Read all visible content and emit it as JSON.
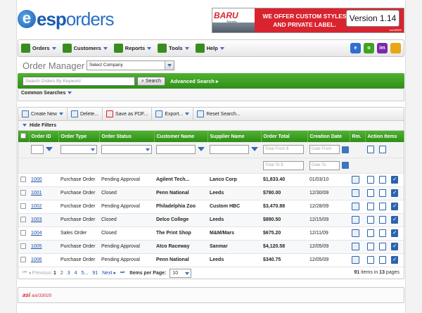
{
  "brand": {
    "logo_letter": "e",
    "logo_main": "esp",
    "logo_sub": "orders"
  },
  "banner": {
    "logo": "BARU",
    "logo_sub": "Sports",
    "line1": "WE OFFER CUSTOM STYLES",
    "line2": "AND PRIVATE LABEL.",
    "asi": "asi/38659",
    "version": "Version 1.14"
  },
  "nav": {
    "items": [
      {
        "label": "Orders",
        "icon": "orders-icon"
      },
      {
        "label": "Customers",
        "icon": "customers-icon"
      },
      {
        "label": "Reports",
        "icon": "reports-icon"
      },
      {
        "label": "Tools",
        "icon": "tools-icon"
      },
      {
        "label": "Help",
        "icon": "help-icon"
      }
    ],
    "right_icons": [
      {
        "name": "esp-icon",
        "text": "e",
        "color": "#2f6fd0"
      },
      {
        "name": "green-app-icon",
        "text": "o",
        "color": "#3ea321"
      },
      {
        "name": "im-icon",
        "text": "im",
        "color": "#7b2aa8"
      },
      {
        "name": "key-icon",
        "text": "",
        "color": "#e7a613"
      }
    ]
  },
  "page": {
    "title": "Order Manager",
    "company_select": "Select Company",
    "search_placeholder": "Search Orders By Keyword",
    "search_button": "Search",
    "advanced_search": "Advanced Search",
    "common_searches": "Common Searches"
  },
  "toolbar": {
    "create_new": "Create New",
    "delete": "Delete...",
    "save_pdf": "Save as PDF...",
    "export": "Export...",
    "reset_search": "Reset Search..."
  },
  "filters": {
    "hide_filters": "Hide Filters",
    "total_from": "Total From $",
    "total_to": "Total To $",
    "date_from": "Date From",
    "date_to": "Date To"
  },
  "columns": [
    "Order ID",
    "Order Type",
    "Order Status",
    "Customer Name",
    "Supplier Name",
    "Order Total",
    "Creation Date",
    "Rm.",
    "Action Items"
  ],
  "rows": [
    {
      "id": "1000",
      "type": "Purchase Order",
      "status": "Pending Approval",
      "customer": "Agilent Tech...",
      "supplier": "Lanco Corp",
      "total": "$1,833.40",
      "date": "01/03/10"
    },
    {
      "id": "1001",
      "type": "Purchase Order",
      "status": "Closed",
      "customer": "Penn National",
      "supplier": "Leeds",
      "total": "$780.00",
      "date": "12/30/09"
    },
    {
      "id": "1002",
      "type": "Purchase Order",
      "status": "Pending Approval",
      "customer": "Philadelphia Zoo",
      "supplier": "Custom HBC",
      "total": "$3,470.88",
      "date": "12/28/09"
    },
    {
      "id": "1003",
      "type": "Purchase Order",
      "status": "Closed",
      "customer": "Delco  College",
      "supplier": "Leeds",
      "total": "$890.50",
      "date": "12/15/09"
    },
    {
      "id": "1004",
      "type": "Sales Order",
      "status": "Closed",
      "customer": "The Print Shop",
      "supplier": "M&M/Mars",
      "total": "$675.20",
      "date": "12/11/09"
    },
    {
      "id": "1005",
      "type": "Purchase Order",
      "status": "Pending Approval",
      "customer": "Atco Raceway",
      "supplier": "Sanmar",
      "total": "$4,120.58",
      "date": "12/05/09"
    },
    {
      "id": "1006",
      "type": "Purchase Order",
      "status": "Pending Approval",
      "customer": "Penn National",
      "supplier": "Leeds",
      "total": "$340.75",
      "date": "12/05/09"
    }
  ],
  "pager": {
    "previous": "Previous",
    "pages": [
      "1",
      "2",
      "3",
      "4",
      "5...",
      "91"
    ],
    "next": "Next",
    "items_per_page_label": "Items per Page:",
    "items_per_page": "10",
    "summary_count": "91",
    "summary_mid": "items in",
    "summary_pages": "13",
    "summary_end": "pages"
  },
  "footer": {
    "asi_logo": "asi",
    "asi_number": "asi/33020"
  }
}
